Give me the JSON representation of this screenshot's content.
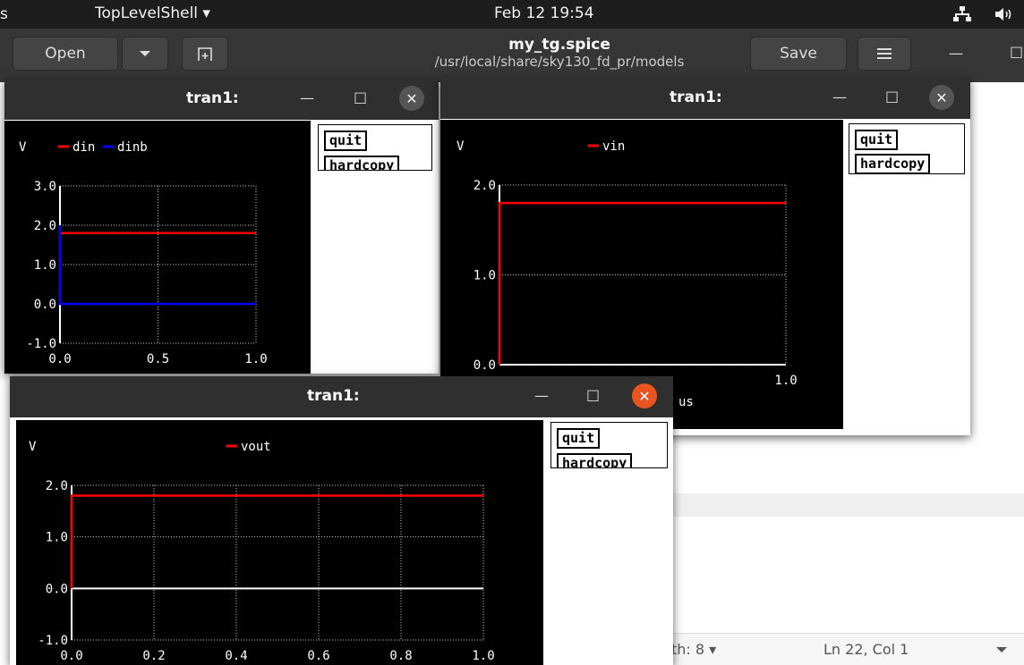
{
  "topbar": {
    "activities": "s",
    "app_menu": "TopLevelShell ▾",
    "clock": "Feb 12  19:54",
    "icons": [
      "network-icon",
      "volume-icon"
    ]
  },
  "gedit": {
    "open_label": "Open",
    "title": "my_tg.spice",
    "path": "/usr/local/share/sky130_fd_pr/models",
    "save_label": "Save",
    "tab_width": "th: 8 ▾",
    "cursor": "Ln 22, Col 1",
    "minimize": "—",
    "maximize": "□"
  },
  "plot_windows": [
    {
      "title": "tran1:",
      "buttons": {
        "quit": "quit",
        "hardcopy": "hardcopy"
      },
      "chart_data": {
        "type": "line",
        "ylabel": "V",
        "xlim": [
          0.0,
          1.0
        ],
        "ylim": [
          -1.0,
          3.0
        ],
        "x_ticks": [
          "0.0",
          "0.5",
          "1.0"
        ],
        "y_ticks": [
          "-1.0",
          "0.0",
          "1.0",
          "2.0",
          "3.0"
        ],
        "series": [
          {
            "name": "din",
            "color": "#ff0000",
            "x": [
              0.0,
              0.0,
              1.0
            ],
            "y": [
              0.0,
              1.8,
              1.8
            ]
          },
          {
            "name": "dinb",
            "color": "#0000ff",
            "x": [
              0.0,
              0.0,
              1.0
            ],
            "y": [
              2.0,
              0.0,
              0.0
            ]
          }
        ]
      }
    },
    {
      "title": "tran1:",
      "buttons": {
        "quit": "quit",
        "hardcopy": "hardcopy"
      },
      "chart_data": {
        "type": "line",
        "ylabel": "V",
        "xlabel": "us",
        "xlim": [
          0.0,
          1.0
        ],
        "ylim": [
          0.0,
          2.0
        ],
        "x_ticks": [
          "1.0"
        ],
        "y_ticks": [
          "0.0",
          "1.0",
          "2.0"
        ],
        "series": [
          {
            "name": "vin",
            "color": "#ff0000",
            "x": [
              0.0,
              0.0,
              1.0
            ],
            "y": [
              0.0,
              1.8,
              1.8
            ]
          }
        ]
      }
    },
    {
      "title": "tran1:",
      "buttons": {
        "quit": "quit",
        "hardcopy": "hardcopy"
      },
      "chart_data": {
        "type": "line",
        "ylabel": "V",
        "xlim": [
          0.0,
          1.0
        ],
        "ylim": [
          -1.0,
          2.0
        ],
        "x_ticks": [
          "0.0",
          "0.2",
          "0.4",
          "0.6",
          "0.8",
          "1.0"
        ],
        "y_ticks": [
          "-1.0",
          "0.0",
          "1.0",
          "2.0"
        ],
        "series": [
          {
            "name": "vout",
            "color": "#ff0000",
            "x": [
              0.0,
              0.0,
              1.0
            ],
            "y": [
              0.0,
              1.8,
              1.8
            ]
          }
        ]
      }
    }
  ],
  "window_controls": {
    "minimize": "—",
    "maximize": "□",
    "close": "✕"
  }
}
